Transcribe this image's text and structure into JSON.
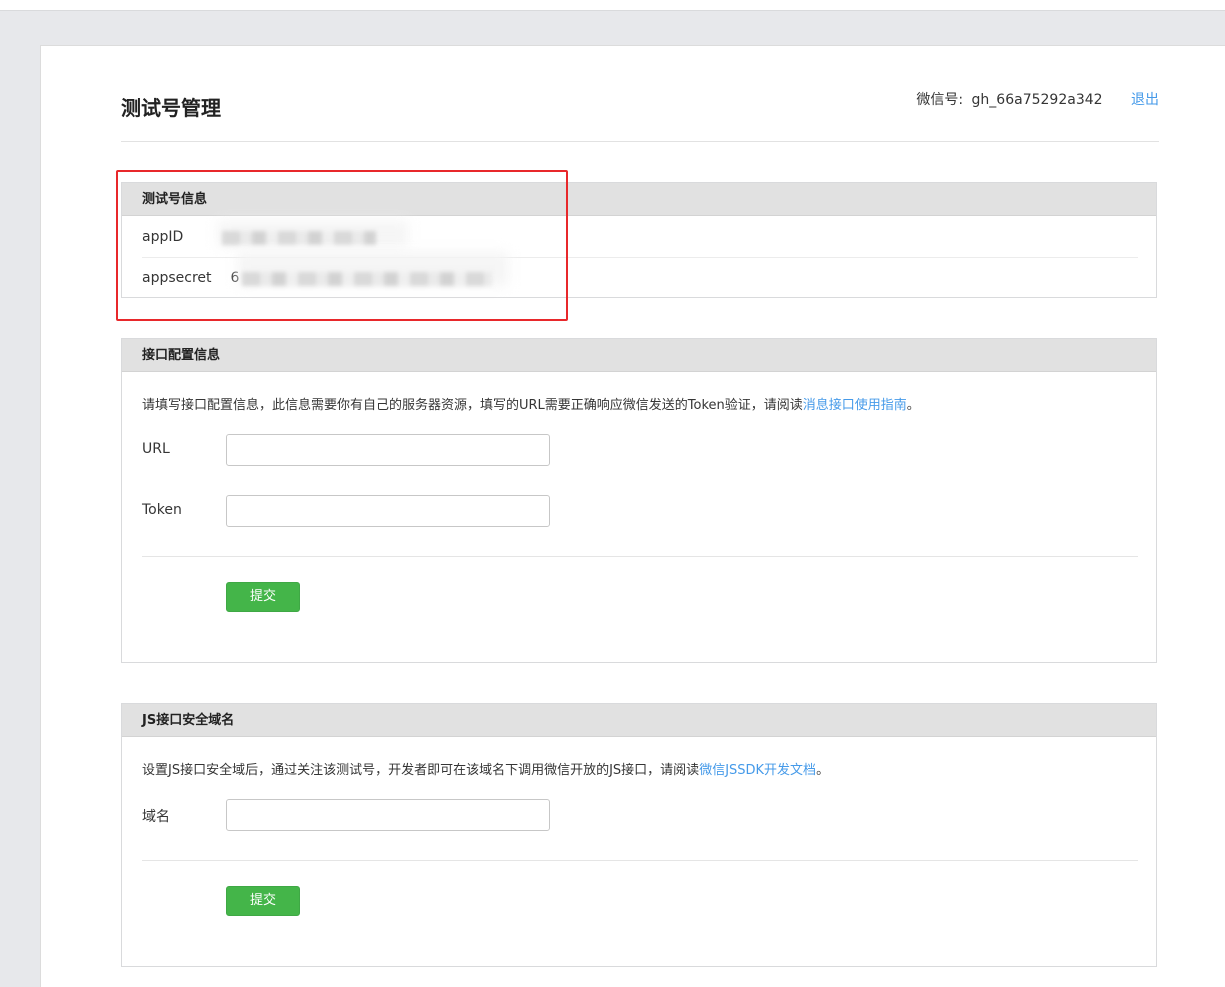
{
  "header": {
    "title": "测试号管理",
    "wechat_label": "微信号:",
    "wechat_id": "gh_66a75292a342",
    "logout": "退出"
  },
  "test_account": {
    "title": "测试号信息",
    "appid_label": "appID",
    "appsecret_label": "appsecret",
    "appsecret_prefix": "6"
  },
  "interface_config": {
    "title": "接口配置信息",
    "description": "请填写接口配置信息，此信息需要你有自己的服务器资源，填写的URL需要正确响应微信发送的Token验证，请阅读",
    "link": "消息接口使用指南",
    "description_end": "。",
    "url_label": "URL",
    "url_value": "",
    "token_label": "Token",
    "token_value": "",
    "submit": "提交"
  },
  "js_domain": {
    "title": "JS接口安全域名",
    "description": "设置JS接口安全域后，通过关注该测试号，开发者即可在该域名下调用微信开放的JS接口，请阅读",
    "link": "微信JSSDK开发文档",
    "description_end": "。",
    "domain_label": "域名",
    "domain_value": "",
    "submit": "提交"
  },
  "colors": {
    "accent_link": "#459ae9",
    "submit_green": "#44b549",
    "highlight_red": "#e8282b"
  }
}
